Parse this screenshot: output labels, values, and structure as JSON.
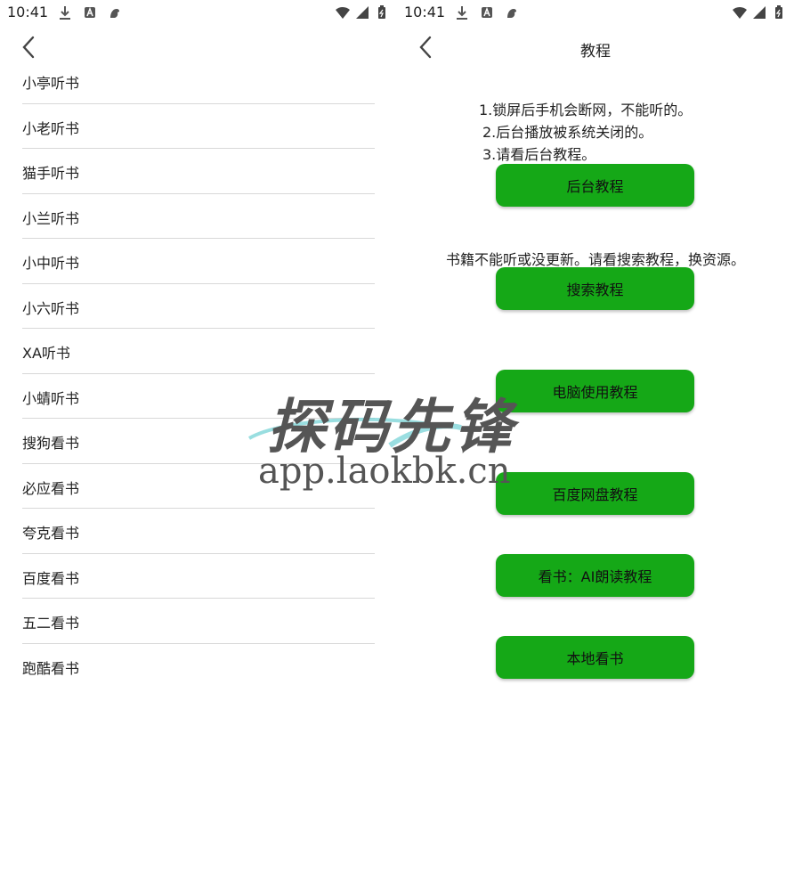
{
  "status": {
    "time": "10:41"
  },
  "left": {
    "items": [
      "小亭听书",
      "小老听书",
      "猫手听书",
      "小兰听书",
      "小中听书",
      "小六听书",
      "XA听书",
      "小蜻听书",
      "搜狗看书",
      "必应看书",
      "夸克看书",
      "百度看书",
      "五二看书",
      "跑酷看书"
    ]
  },
  "right": {
    "title": "教程",
    "notes": [
      "1.锁屏后手机会断网，不能听的。",
      "2.后台播放被系统关闭的。",
      "3.请看后台教程。"
    ],
    "notice2": "书籍不能听或没更新。请看搜索教程，换资源。",
    "buttons": [
      "后台教程",
      "搜索教程",
      "电脑使用教程",
      "百度网盘教程",
      "看书：AI朗读教程",
      "本地看书"
    ]
  },
  "watermark": {
    "title": "探码先锋",
    "url": "app.laokbk.cn"
  },
  "colors": {
    "button": "#15a817",
    "divider": "#d8d8d8"
  }
}
